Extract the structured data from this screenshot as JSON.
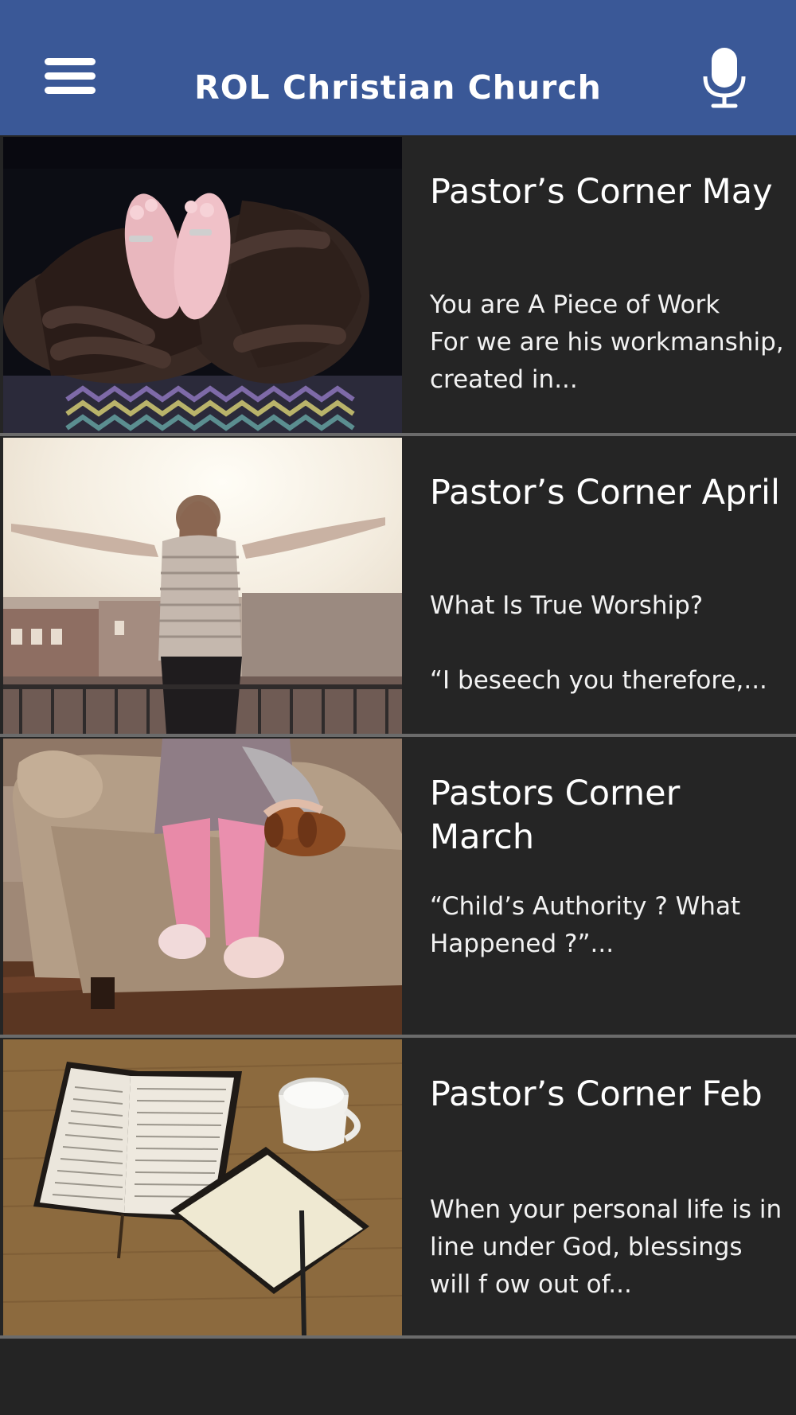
{
  "app_bar": {
    "title": "ROL Christian Church",
    "menu_icon": "hamburger-menu-icon",
    "mic_icon": "microphone-icon",
    "color": "#3a5897"
  },
  "posts": [
    {
      "title": "Pastor’s Corner May",
      "excerpt": "You are A Piece of Work\nFor we are his workmanship, created in...",
      "image": "parents-hands-holding-baby-feet"
    },
    {
      "title": "Pastor’s Corner April",
      "excerpt": "What Is True Worship?\n\n“I beseech you therefore,...",
      "image": "woman-arms-outstretched-at-sunrise"
    },
    {
      "title": "Pastors Corner March",
      "excerpt": "“Child’s Authority ? What Happened ?”...",
      "image": "child-on-sofa-with-puppy"
    },
    {
      "title": "Pastor’s Corner Feb",
      "excerpt": "When your personal life is in line under God, blessings will f ow out of...",
      "image": "open-bible-notebook-and-cup"
    }
  ]
}
